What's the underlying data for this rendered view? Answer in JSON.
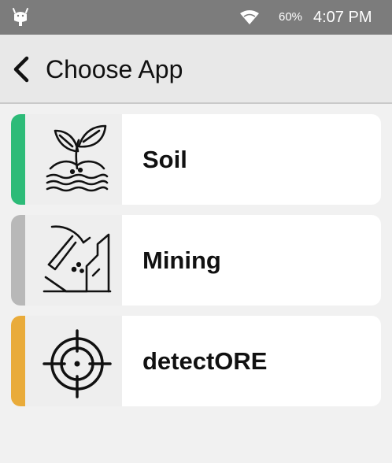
{
  "status_bar": {
    "left_icon": "android-icon",
    "wifi_icon": "wifi-icon",
    "battery": "60%",
    "time": "4:07 PM"
  },
  "header": {
    "back_icon": "chevron-left-icon",
    "title": "Choose App"
  },
  "apps": [
    {
      "label": "Soil",
      "icon": "plant-icon",
      "accent": "#2dbb78"
    },
    {
      "label": "Mining",
      "icon": "pickaxe-icon",
      "accent": "#b8b8b8"
    },
    {
      "label": "detectORE",
      "icon": "crosshair-icon",
      "accent": "#e9ab3a"
    }
  ]
}
